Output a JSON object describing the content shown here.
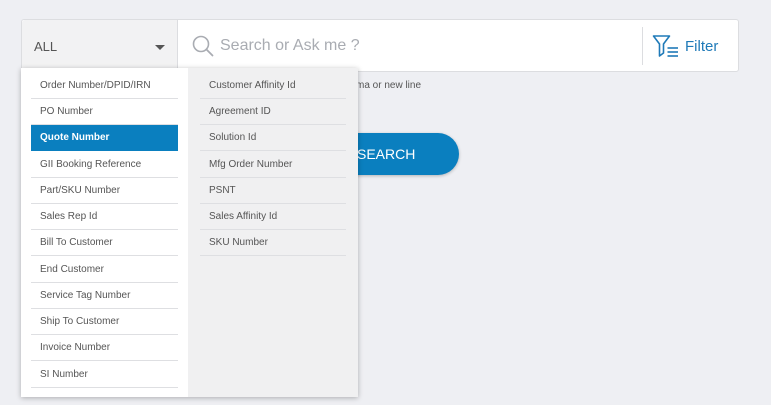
{
  "search": {
    "scope_value": "ALL",
    "placeholder": "Search or Ask me ?",
    "filter_label": "Filter",
    "hint": "ma or new line",
    "submit_label": "SEARCH"
  },
  "dropdown": {
    "selected": "Quote Number",
    "left_options": [
      "Order Number/DPID/IRN",
      "PO Number",
      "Quote Number",
      "GII Booking Reference",
      "Part/SKU Number",
      "Sales Rep Id",
      "Bill To Customer",
      "End Customer",
      "Service Tag Number",
      "Ship To Customer",
      "Invoice Number",
      "SI Number"
    ],
    "right_options": [
      "Customer Affinity Id",
      "Agreement ID",
      "Solution Id",
      "Mfg Order Number",
      "PSNT",
      "Sales Affinity Id",
      "SKU Number"
    ]
  },
  "colors": {
    "accent": "#0a7fbf",
    "background": "#eeeff3"
  },
  "icons": {
    "search": "search-icon",
    "filter": "filter-icon",
    "caret": "chevron-down-icon"
  }
}
